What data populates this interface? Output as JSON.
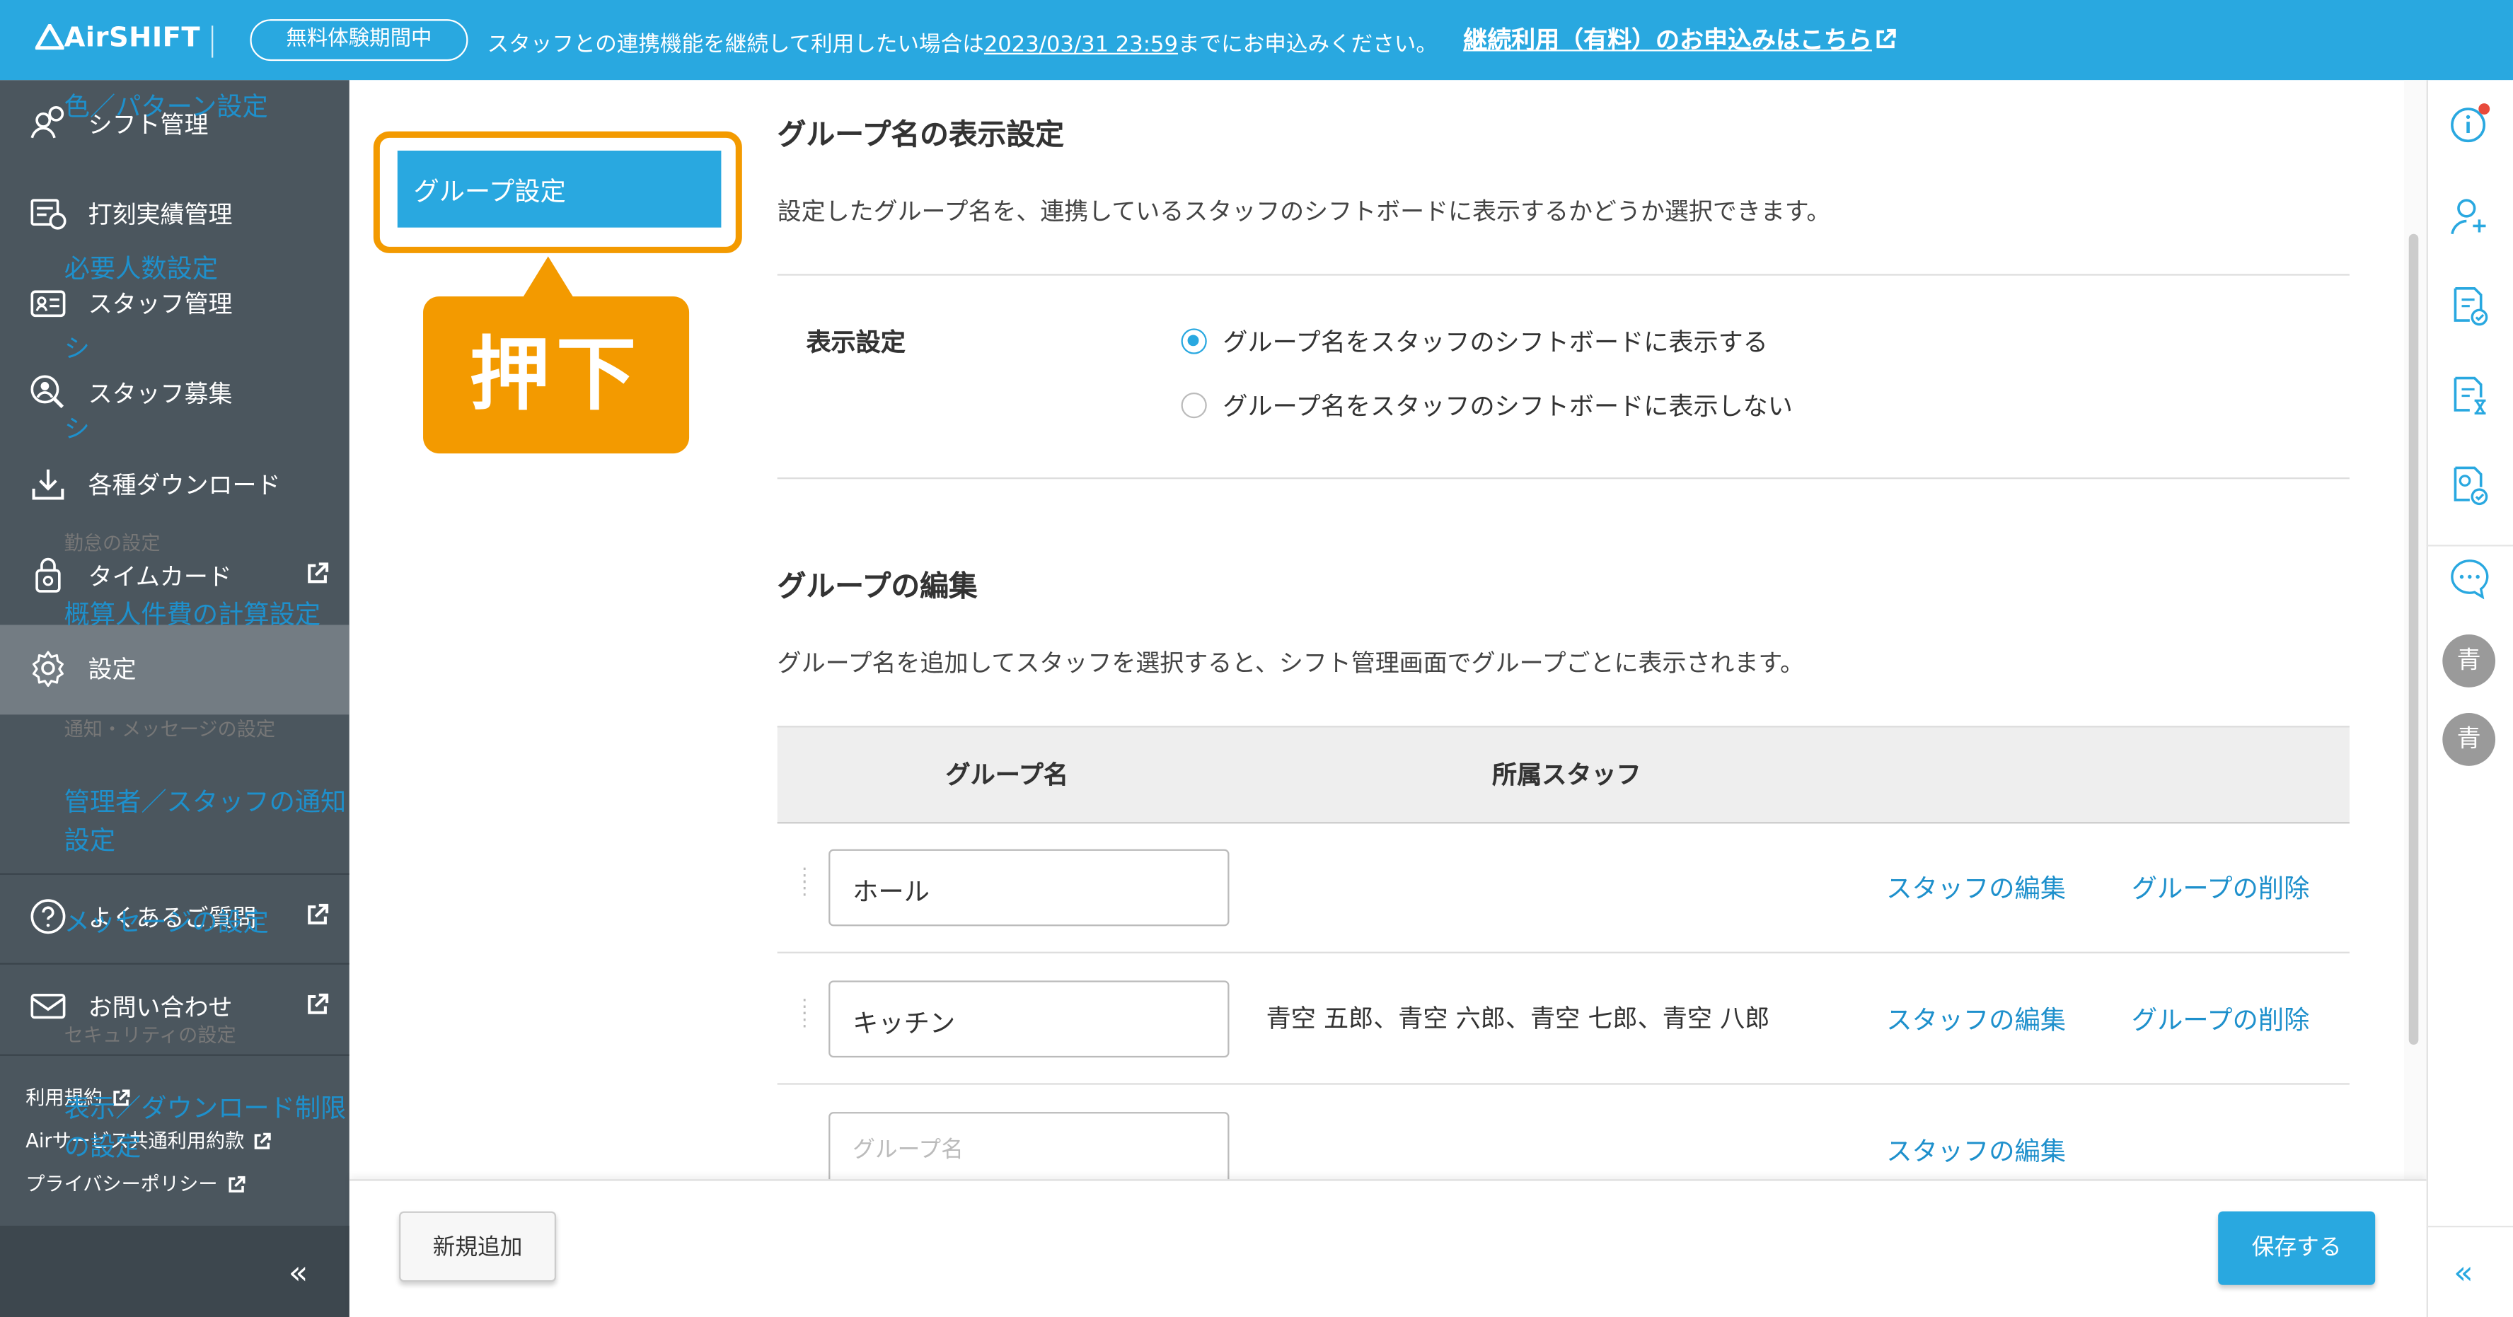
{
  "topbar": {
    "logo": "AirSHIFT",
    "trial_badge": "無料体験期間中",
    "message_before": "スタッフとの連携機能を継続して利用したい場合は",
    "message_date": "2023/03/31 23:59",
    "message_after": "までにお申込みください。",
    "continue_link": "継続利用（有料）のお申込みはこちら"
  },
  "sidebar": {
    "items": [
      {
        "label": "シフト管理",
        "icon": "shift-icon"
      },
      {
        "label": "打刻実績管理",
        "icon": "timestamp-icon"
      },
      {
        "label": "スタッフ管理",
        "icon": "staff-card-icon"
      },
      {
        "label": "スタッフ募集",
        "icon": "recruit-icon"
      },
      {
        "label": "各種ダウンロード",
        "icon": "download-icon"
      },
      {
        "label": "タイムカード",
        "icon": "timecard-icon"
      },
      {
        "label": "設定",
        "icon": "gear-icon",
        "active": true
      }
    ],
    "help": "よくあるご質問",
    "contact": "お問い合わせ",
    "links": [
      "利用規約",
      "Airサービス共通利用約款",
      "プライバシーポリシー"
    ],
    "collapse": "«"
  },
  "submenu": {
    "color_pattern": "色／パターン設定",
    "group_setting": "グループ設定",
    "required_staff": "必要人数設定",
    "hidden_item_1": "シ",
    "hidden_item_2": "シ",
    "attendance_head": "勤怠の設定",
    "labor_cost": "概算人件費の計算設定",
    "notify_head": "通知・メッセージの設定",
    "notify_setting": "管理者／スタッフの通知設定",
    "message_setting": "メッセージの設定",
    "security_head": "セキュリティの設定",
    "display_limit": "表示／ダウンロード制限の設定"
  },
  "callout": "押下",
  "display_section": {
    "title": "グループ名の表示設定",
    "description": "設定したグループ名を、連携しているスタッフのシフトボードに表示するかどうか選択できます。",
    "label": "表示設定",
    "option_show": "グループ名をスタッフのシフトボードに表示する",
    "option_hide": "グループ名をスタッフのシフトボードに表示しない",
    "selected": "show"
  },
  "edit_section": {
    "title": "グループの編集",
    "description": "グループ名を追加してスタッフを選択すると、シフト管理画面でグループごとに表示されます。",
    "col_group": "グループ名",
    "col_staff": "所属スタッフ",
    "rows": [
      {
        "name": "ホール",
        "staff": "",
        "edit": "スタッフの編集",
        "delete": "グループの削除"
      },
      {
        "name": "キッチン",
        "staff": "青空 五郎、青空 六郎、青空 七郎、青空 八郎",
        "edit": "スタッフの編集",
        "delete": "グループの削除"
      },
      {
        "name": "",
        "placeholder": "グループ名",
        "staff": "",
        "edit": "スタッフの編集"
      }
    ]
  },
  "footer": {
    "add_button": "新規追加",
    "save_button": "保存する"
  },
  "rightrail": {
    "avatars": [
      "青",
      "青"
    ],
    "collapse": "«"
  },
  "colors": {
    "brand": "#29a8e0",
    "sidebar": "#4b565e",
    "highlight": "#f39a00",
    "link": "#1e90cc"
  }
}
